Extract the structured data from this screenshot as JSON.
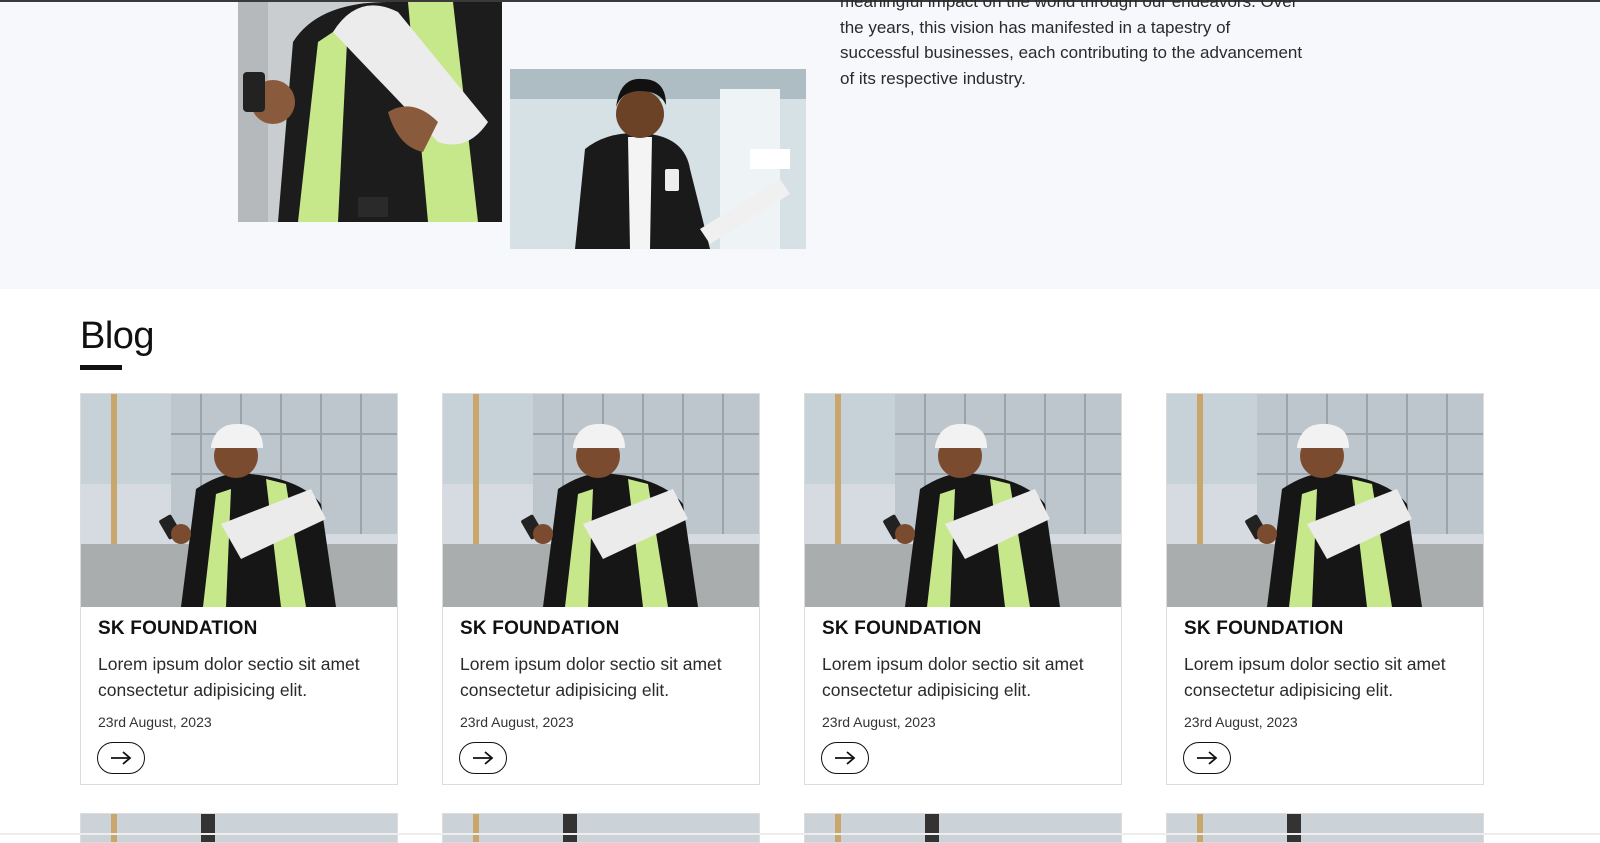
{
  "about": {
    "paragraph_lines": [
      "meaningful impact on the world through our endeavors. Over",
      "the years, this vision has manifested in a tapestry of",
      "successful businesses, each contributing to the advancement",
      "of its respective industry."
    ]
  },
  "blog": {
    "heading": "Blog",
    "cards": [
      {
        "title": "SK FOUNDATION",
        "text": "Lorem ipsum dolor sectio sit amet consectetur adipisicing elit.",
        "date": "23rd August, 2023",
        "button_icon": "arrow-right-icon"
      },
      {
        "title": "SK FOUNDATION",
        "text": "Lorem ipsum dolor sectio sit amet consectetur adipisicing elit.",
        "date": "23rd August, 2023",
        "button_icon": "arrow-right-icon"
      },
      {
        "title": "SK FOUNDATION",
        "text": "Lorem ipsum dolor sectio sit amet consectetur adipisicing elit.",
        "date": "23rd August, 2023",
        "button_icon": "arrow-right-icon"
      },
      {
        "title": "SK FOUNDATION",
        "text": "Lorem ipsum dolor sectio sit amet consectetur adipisicing elit.",
        "date": "23rd August, 2023",
        "button_icon": "arrow-right-icon"
      }
    ]
  },
  "colors": {
    "about_background": "#f7f8fc",
    "text": "#1a1a1a",
    "card_border": "#dcdcdc",
    "vest_green": "#c6e88a"
  }
}
